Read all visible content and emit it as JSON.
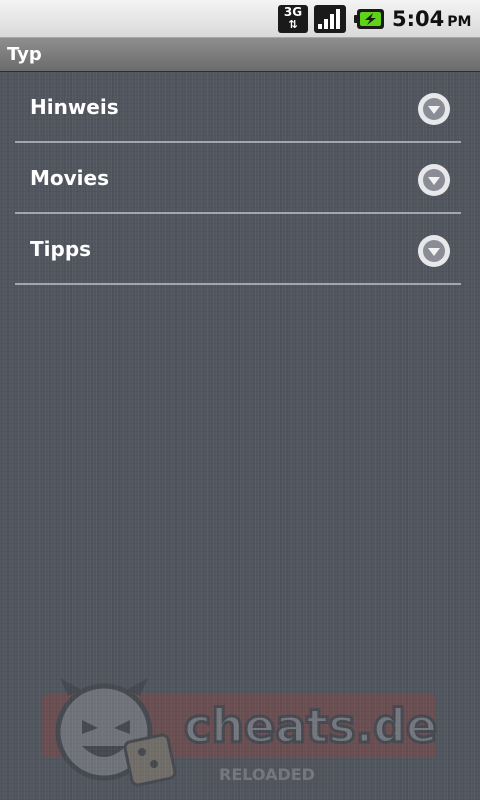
{
  "status_bar": {
    "network_label": "3G",
    "network_arrows": "⇅",
    "time": "5:04",
    "ampm": "PM"
  },
  "app": {
    "title": "Typ"
  },
  "list": {
    "items": [
      {
        "label": "Hinweis"
      },
      {
        "label": "Movies"
      },
      {
        "label": "Tipps"
      }
    ]
  },
  "watermark": {
    "brand": "cheats.de",
    "tagline": "RELOADED"
  },
  "colors": {
    "background": "#52565f",
    "battery_accent": "#5fd31a",
    "watermark_red": "#c0392b"
  }
}
